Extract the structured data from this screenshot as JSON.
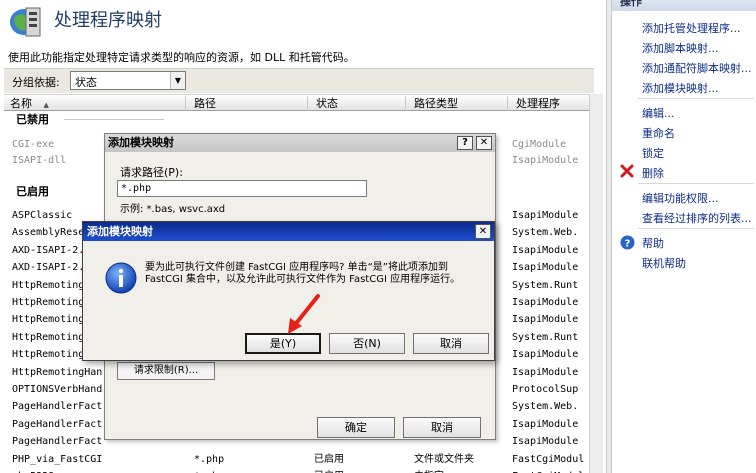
{
  "header": {
    "title": "处理程序映射",
    "description": "使用此功能指定处理特定请求类型的响应的资源，如 DLL 和托管代码。"
  },
  "group_bar": {
    "label": "分组依据:",
    "selected": "状态"
  },
  "table": {
    "columns": [
      "名称",
      "路径",
      "状态",
      "路径类型",
      "处理程序"
    ],
    "sort_indicator": "▲",
    "group_disabled": "已禁用",
    "group_enabled": "已启用",
    "disabled_rows": [
      {
        "name": "CGI-exe",
        "handler": "CgiModule"
      },
      {
        "name": "ISAPI-dll",
        "handler": "IsapiModule"
      }
    ],
    "enabled_rows": [
      {
        "name": "ASPClassic",
        "path": "",
        "state": "",
        "type": "",
        "handler": "IsapiModule"
      },
      {
        "name": "AssemblyRese",
        "path": "",
        "state": "",
        "type": "",
        "handler": "System.Web."
      },
      {
        "name": "AXD-ISAPI-2.",
        "path": "",
        "state": "",
        "type": "",
        "handler": "IsapiModule"
      },
      {
        "name": "AXD-ISAPI-2.",
        "path": "",
        "state": "",
        "type": "",
        "handler": "IsapiModule"
      },
      {
        "name": "HttpRemoting",
        "path": "",
        "state": "",
        "type": "",
        "handler": "System.Runt"
      },
      {
        "name": "HttpRemoting",
        "path": "",
        "state": "",
        "type": "",
        "handler": "IsapiModule"
      },
      {
        "name": "HttpRemoting",
        "path": "",
        "state": "",
        "type": "",
        "handler": "IsapiModule"
      },
      {
        "name": "HttpRemoting",
        "path": "",
        "state": "",
        "type": "",
        "handler": "System.Runt"
      },
      {
        "name": "HttpRemoting",
        "path": "",
        "state": "",
        "type": "",
        "handler": "IsapiModule"
      },
      {
        "name": "HttpRemotingHan",
        "path": "",
        "state": "",
        "type": "",
        "handler": "IsapiModule"
      },
      {
        "name": "OPTIONSVerbHand",
        "path": "",
        "state": "",
        "type": "",
        "handler": "ProtocolSup"
      },
      {
        "name": "PageHandlerFact",
        "path": "",
        "state": "",
        "type": "",
        "handler": "System.Web."
      },
      {
        "name": "PageHandlerFact",
        "path": "",
        "state": "",
        "type": "",
        "handler": "IsapiModule"
      },
      {
        "name": "PageHandlerFact",
        "path": "",
        "state": "",
        "type": "",
        "handler": "IsapiModule"
      },
      {
        "name": "PHP_via_FastCGI",
        "path": "*.php",
        "state": "已启用",
        "type": "文件或文件夹",
        "handler": "FastCgiModul"
      },
      {
        "name": "php5328",
        "path": "*.php",
        "state": "已启用",
        "type": "未指定",
        "handler": "FastCgiModul"
      }
    ]
  },
  "actions": {
    "header": "操作",
    "items": [
      "添加托管处理程序...",
      "添加脚本映射...",
      "添加通配符脚本映射...",
      "添加模块映射...",
      "编辑...",
      "重命名",
      "锁定",
      "删除",
      "编辑功能权限...",
      "查看经过排序的列表...",
      "帮助",
      "联机帮助"
    ]
  },
  "dialog_mapping": {
    "title": "添加模块映射",
    "help_btn": "?",
    "close_btn": "✕",
    "path_label": "请求路径(P):",
    "path_value": "*.php",
    "example": "示例: *.bas, wsvc.axd",
    "restrict_btn": "请求限制(R)...",
    "ok": "确定",
    "cancel": "取消"
  },
  "dialog_confirm": {
    "title": "添加模块映射",
    "close_btn": "✕",
    "message": "要为此可执行文件创建 FastCGI 应用程序吗? 单击“是”将此项添加到 FastCGI 集合中，以及允许此可执行文件作为 FastCGI 应用程序运行。",
    "yes": "是(Y)",
    "no": "否(N)",
    "cancel": "取消"
  },
  "colors": {
    "title_blue": "#1f3f66",
    "link_blue": "#0d2d8a",
    "dialog_title_gradient": "#0b2a8a",
    "annotation_red": "#e8201a"
  }
}
